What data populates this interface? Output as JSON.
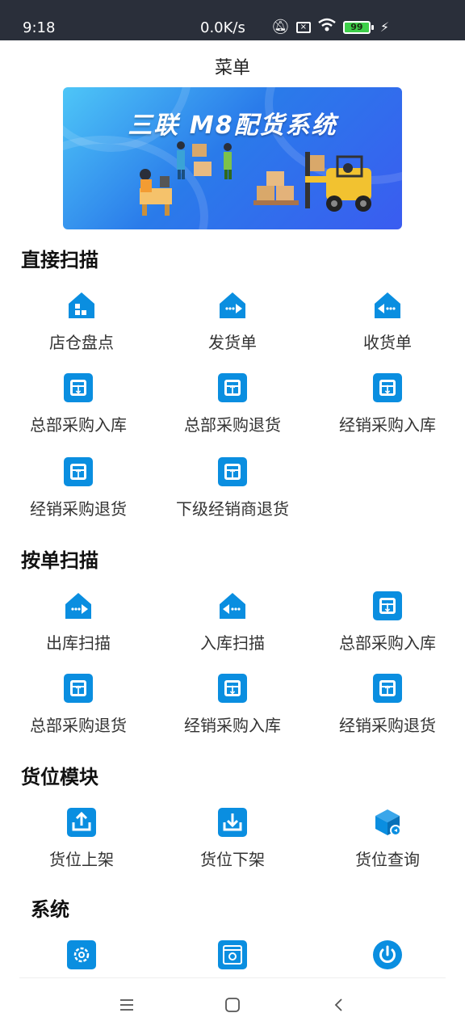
{
  "status_bar": {
    "time": "9:18",
    "speed": "0.0K/s",
    "battery": "99"
  },
  "header": {
    "title": "菜单"
  },
  "banner": {
    "title": "三联 M8配货系统"
  },
  "sections": {
    "direct_scan": {
      "title": "直接扫描",
      "items": [
        "店仓盘点",
        "发货单",
        "收货单",
        "总部采购入库",
        "总部采购退货",
        "经销采购入库",
        "经销采购退货",
        "下级经销商退货"
      ]
    },
    "order_scan": {
      "title": "按单扫描",
      "items": [
        "出库扫描",
        "入库扫描",
        "总部采购入库",
        "总部采购退货",
        "经销采购入库",
        "经销采购退货"
      ]
    },
    "location": {
      "title": "货位模块",
      "items": [
        "货位上架",
        "货位下架",
        "货位查询"
      ]
    },
    "system": {
      "title": "系统"
    }
  },
  "icons": {
    "accent": "#0a8ee0",
    "types": [
      "warehouse-icon",
      "ship-out-icon",
      "receive-in-icon",
      "box-in-icon",
      "box-out-icon",
      "shelf-up-icon",
      "shelf-down-icon",
      "cube-search-icon",
      "settings-icon",
      "settings-window-icon",
      "power-icon"
    ]
  }
}
